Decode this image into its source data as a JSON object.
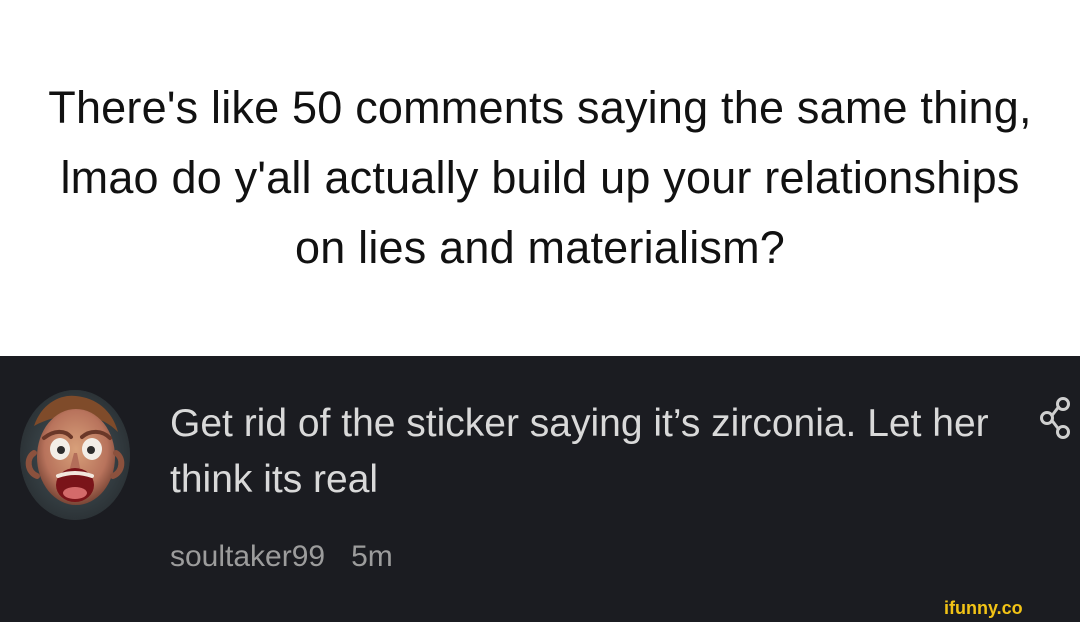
{
  "caption": {
    "text": "There's like 50 comments saying the same thing, lmao do y'all actually build up your relationships on lies and materialism?"
  },
  "comment": {
    "text": "Get rid of the sticker saying it’s zirconia. Let her think its real",
    "username": "soultaker99",
    "time": "5m",
    "avatar_icon": "user-avatar",
    "share_icon": "share-icon"
  },
  "watermark": {
    "text": "ifunny.co"
  },
  "colors": {
    "caption_bg": "#ffffff",
    "comment_bg": "#1b1c21",
    "comment_text": "#d9d9d9",
    "meta_text": "#9c9c9c",
    "watermark": "#f2c316"
  }
}
